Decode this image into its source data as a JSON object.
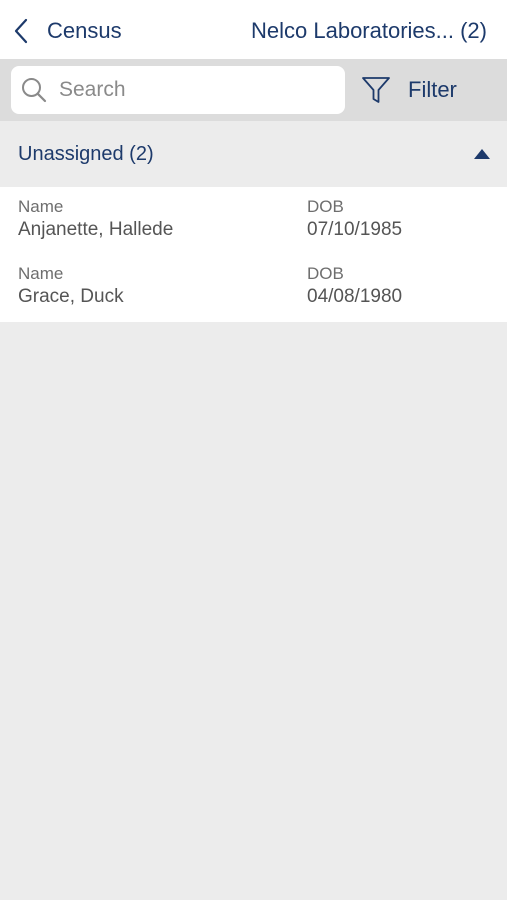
{
  "nav": {
    "back_label": "Census",
    "title": "Nelco Laboratories... (2)"
  },
  "search": {
    "placeholder": "Search",
    "value": ""
  },
  "filter": {
    "label": "Filter"
  },
  "group": {
    "title": "Unassigned (2)",
    "expanded": true
  },
  "patients": [
    {
      "name_label": "Name",
      "name": "Anjanette, Hallede",
      "dob_label": "DOB",
      "dob": "07/10/1985"
    },
    {
      "name_label": "Name",
      "name": "Grace, Duck",
      "dob_label": "DOB",
      "dob": "04/08/1980"
    }
  ],
  "colors": {
    "accent": "#1d3a6b",
    "background": "#ececec",
    "search_bar": "#dcdcdc"
  },
  "icons": {
    "back": "chevron-left-icon",
    "search": "search-icon",
    "filter": "filter-icon",
    "collapse": "caret-up-icon"
  }
}
